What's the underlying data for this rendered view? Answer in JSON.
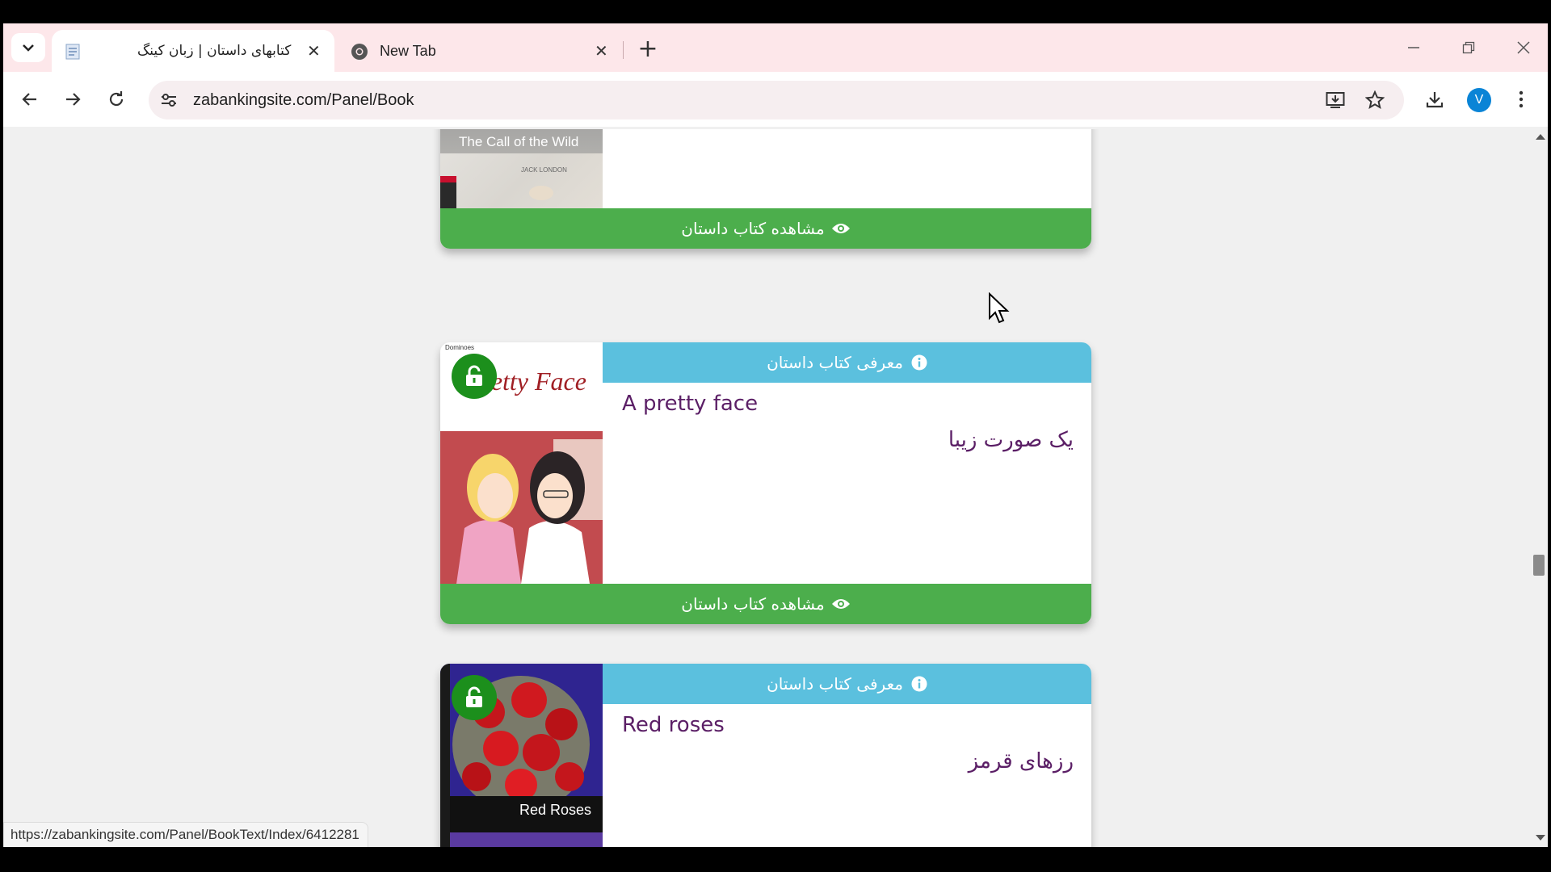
{
  "browser": {
    "tabs": [
      {
        "title": "کتابهای داستان | زبان کینگ",
        "active": true
      },
      {
        "title": "New Tab",
        "active": false
      }
    ],
    "url": "zabankingsite.com/Panel/Book",
    "profile_initial": "V",
    "status_url": "https://zabankingsite.com/Panel/BookText/Index/6412281"
  },
  "books": [
    {
      "cover_title": "The Call of the Wild",
      "cover_author": "JACK LONDON",
      "view_label": "مشاهده کتاب داستان"
    },
    {
      "header_label": "معرفی کتاب داستان",
      "cover_series": "Dominoes",
      "cover_title": "Pretty Face",
      "title_en": "A pretty face",
      "title_fa": "یک صورت زیبا",
      "view_label": "مشاهده کتاب داستان"
    },
    {
      "header_label": "معرفی کتاب داستان",
      "cover_title": "Red Roses",
      "title_en": "Red roses",
      "title_fa": "رزهای قرمز"
    }
  ],
  "colors": {
    "header_blue": "#5bc0de",
    "view_green": "#4cae4c",
    "title_purple": "#5b1f66",
    "lock_green": "#1c8f1c",
    "tabstrip_pink": "#fde7ea"
  }
}
